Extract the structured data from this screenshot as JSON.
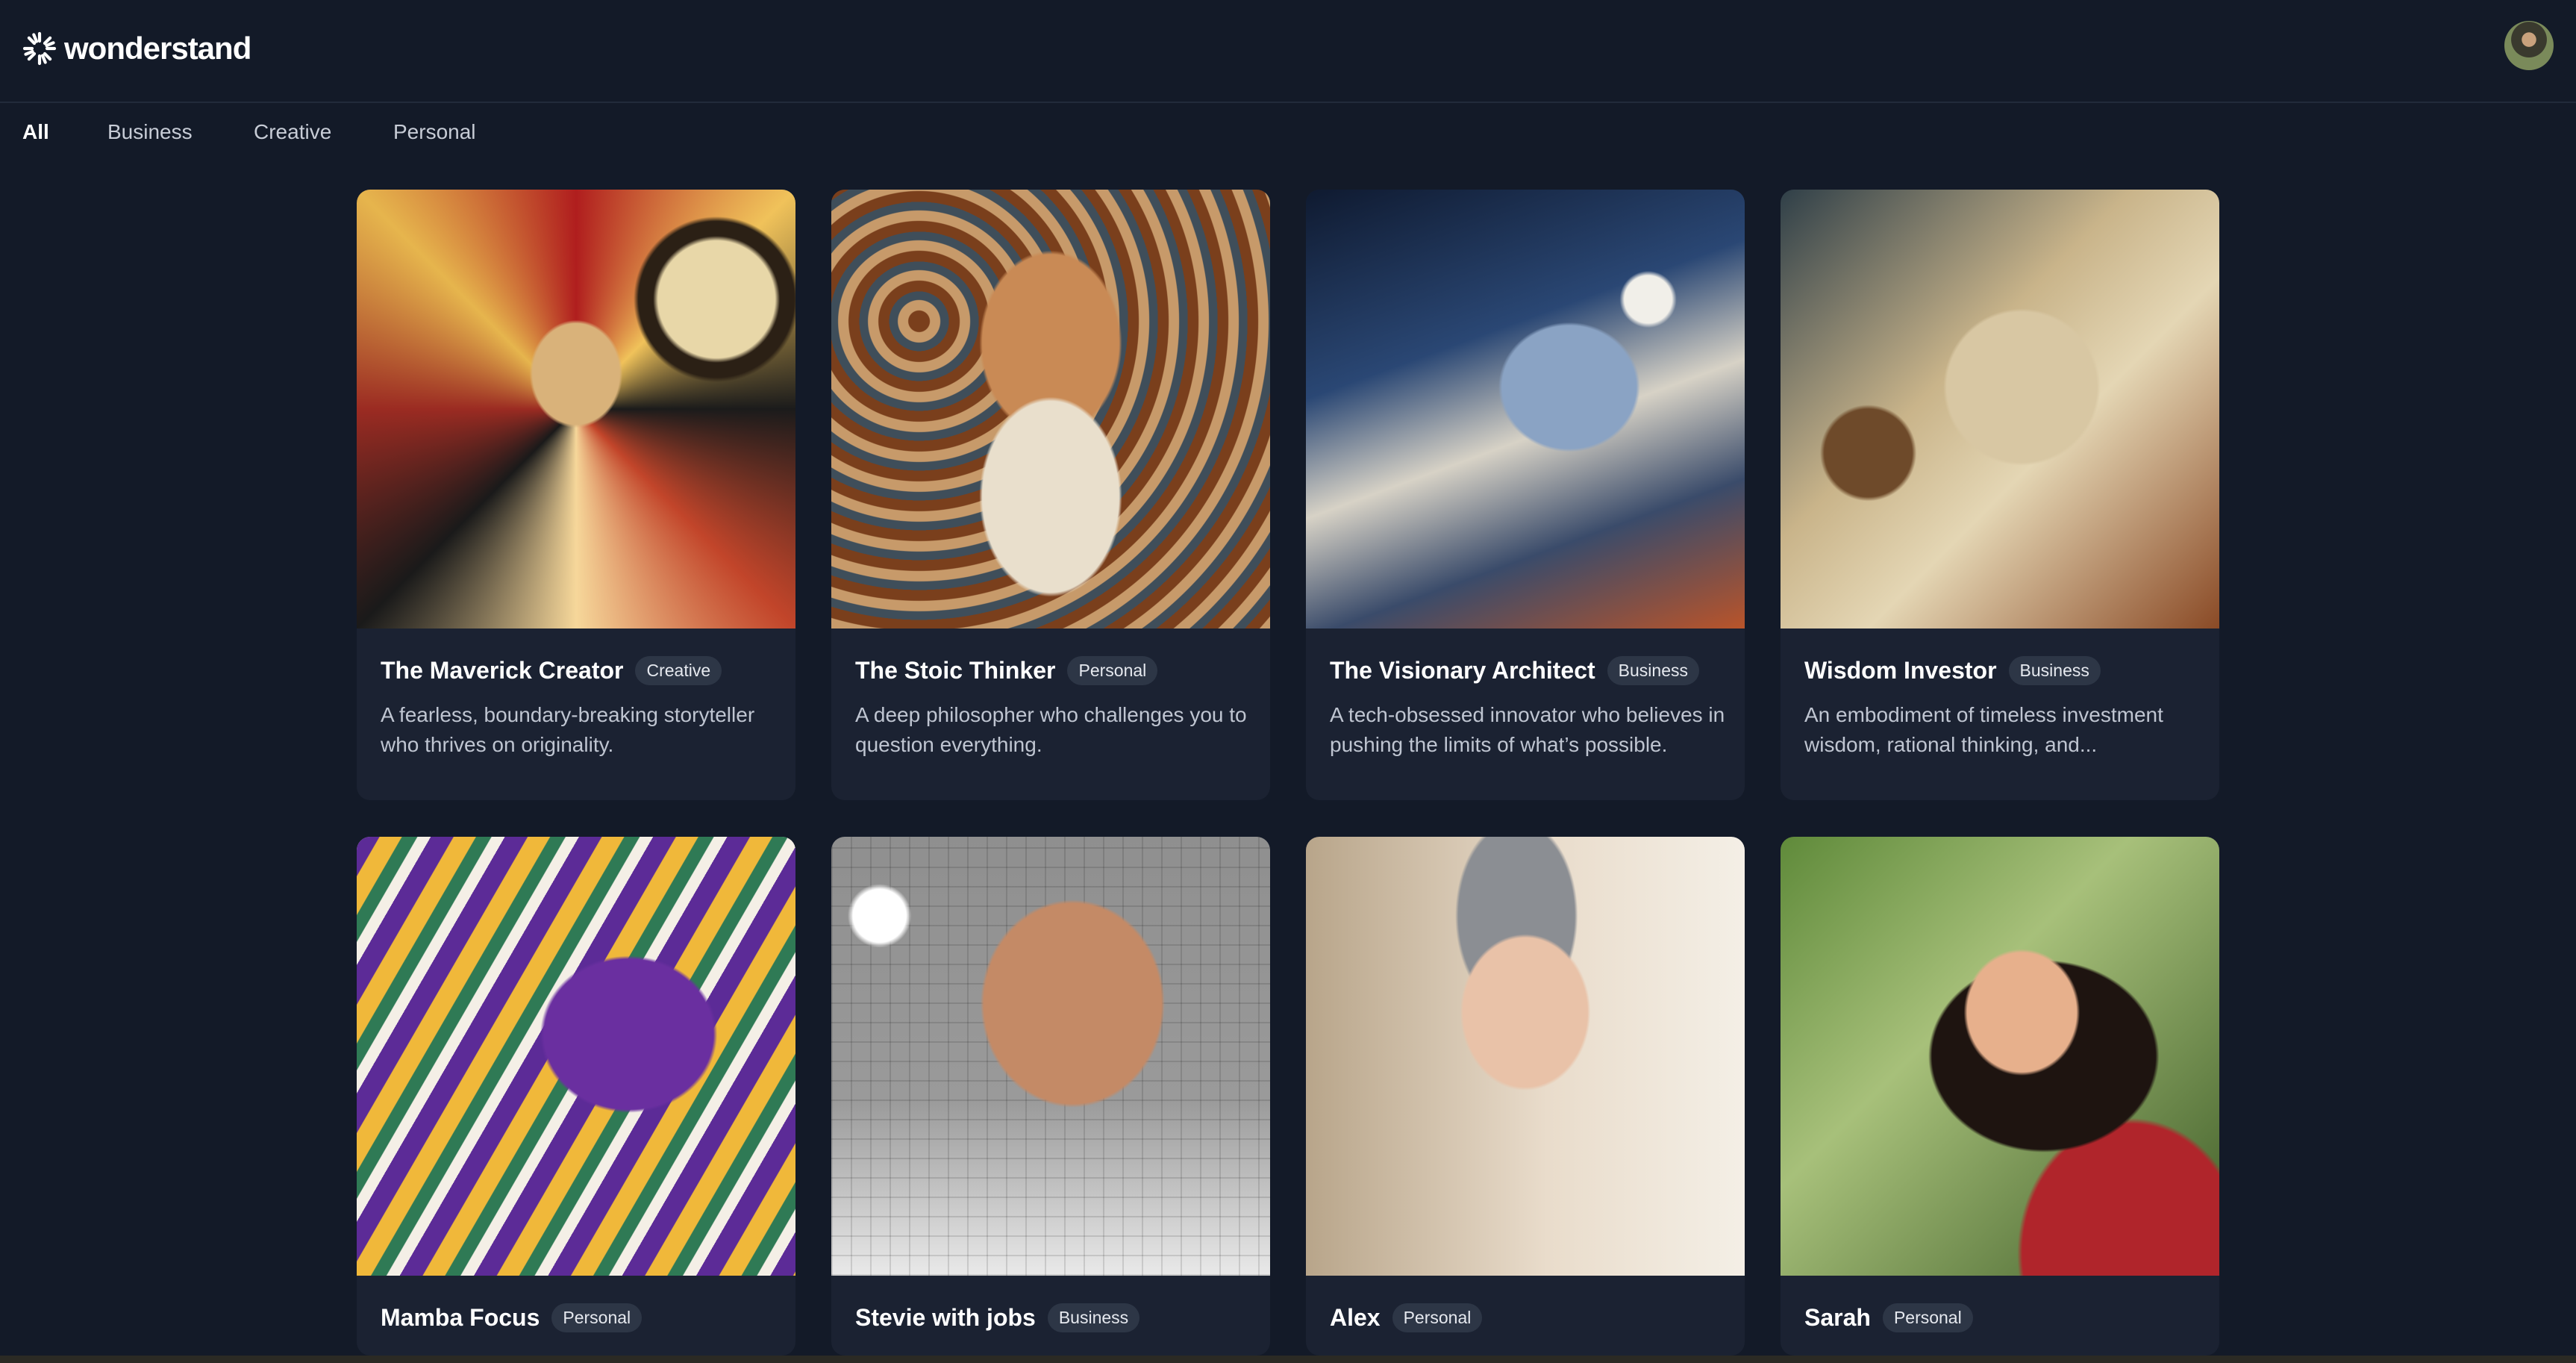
{
  "header": {
    "brand_name": "wonderstand",
    "avatar_label": "user avatar"
  },
  "tabs": [
    {
      "label": "All",
      "active": true
    },
    {
      "label": "Business",
      "active": false
    },
    {
      "label": "Creative",
      "active": false
    },
    {
      "label": "Personal",
      "active": false
    }
  ],
  "cards": [
    {
      "title": "The Maverick Creator",
      "badge": "Creative",
      "description": "A fearless, boundary-breaking storyteller who thrives on originality.",
      "art_icon": "abstract-portrait-film-reel"
    },
    {
      "title": "The Stoic Thinker",
      "badge": "Personal",
      "description": "A deep philosopher who challenges you to question everything.",
      "art_icon": "bearded-philosopher-portrait"
    },
    {
      "title": "The Visionary Architect",
      "badge": "Business",
      "description": "A tech-obsessed innovator who believes in pushing the limits of what’s possible.",
      "art_icon": "rocket-and-car-portrait"
    },
    {
      "title": "Wisdom Investor",
      "badge": "Business",
      "description": "An embodiment of timeless investment wisdom, rational thinking, and...",
      "art_icon": "elderly-investor-portrait"
    },
    {
      "title": "Mamba Focus",
      "badge": "Personal",
      "description": "",
      "art_icon": "stylized-profile-portrait"
    },
    {
      "title": "Stevie with jobs",
      "badge": "Business",
      "description": "",
      "art_icon": "pixel-portrait-apple-logo"
    },
    {
      "title": "Alex",
      "badge": "Personal",
      "description": "",
      "art_icon": "woman-portrait"
    },
    {
      "title": "Sarah",
      "badge": "Personal",
      "description": "",
      "art_icon": "woman-portrait-garden"
    }
  ]
}
